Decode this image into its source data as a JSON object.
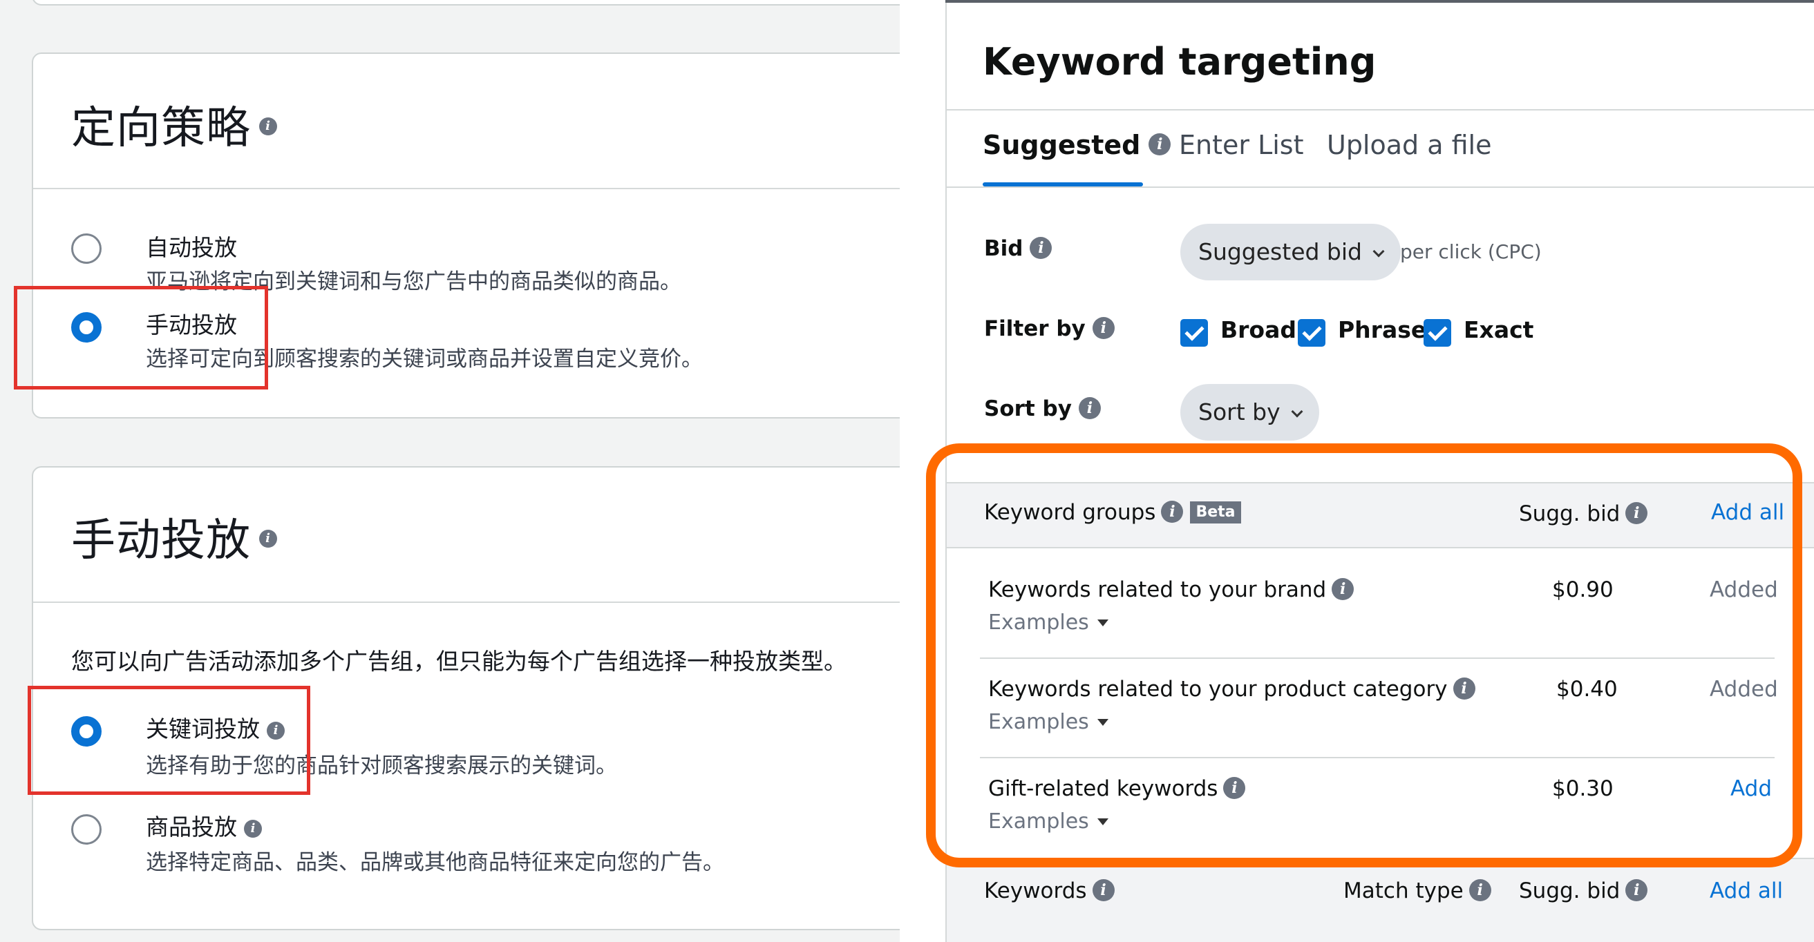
{
  "left_panel": {
    "card1": {
      "title": "定向策略",
      "options": [
        {
          "label": "自动投放",
          "desc": "亚马逊将定向到关键词和与您广告中的商品类似的商品。",
          "selected": false
        },
        {
          "label": "手动投放",
          "desc": "选择可定向到顾客搜索的关键词或商品并设置自定义竞价。",
          "selected": true
        }
      ]
    },
    "card2": {
      "title": "手动投放",
      "intro": "您可以向广告活动添加多个广告组，但只能为每个广告组选择一种投放类型。",
      "options": [
        {
          "label": "关键词投放",
          "desc": "选择有助于您的商品针对顾客搜索展示的关键词。",
          "selected": true
        },
        {
          "label": "商品投放",
          "desc": "选择特定商品、品类、品牌或其他商品特征来定向您的广告。",
          "selected": false
        }
      ]
    },
    "info_icon": "i"
  },
  "right_panel": {
    "title": "Keyword targeting",
    "tabs": [
      {
        "label": "Suggested",
        "active": true
      },
      {
        "label": "Enter List",
        "active": false
      },
      {
        "label": "Upload a file",
        "active": false
      }
    ],
    "bid": {
      "label": "Bid",
      "dropdown": "Suggested bid",
      "suffix": "per click (CPC)"
    },
    "filter": {
      "label": "Filter by",
      "options": [
        {
          "label": "Broad",
          "checked": true
        },
        {
          "label": "Phrase",
          "checked": true
        },
        {
          "label": "Exact",
          "checked": true
        }
      ]
    },
    "sort": {
      "label": "Sort by",
      "dropdown": "Sort by"
    },
    "groups": {
      "header": {
        "name": "Keyword groups",
        "badge": "Beta",
        "bid": "Sugg. bid",
        "action": "Add all"
      },
      "rows": [
        {
          "name": "Keywords related to your brand",
          "examples": "Examples",
          "bid": "$0.90",
          "action": "Added"
        },
        {
          "name": "Keywords related to your product category",
          "examples": "Examples",
          "bid": "$0.40",
          "action": "Added"
        },
        {
          "name": "Gift-related keywords",
          "examples": "Examples",
          "bid": "$0.30",
          "action": "Add"
        }
      ]
    },
    "keywords_header": {
      "name": "Keywords",
      "match": "Match type",
      "bid": "Sugg. bid",
      "action": "Add all"
    }
  },
  "colors": {
    "highlight_red": "#e3332c",
    "highlight_orange": "#ff6a00",
    "accent_blue": "#0972d3"
  }
}
